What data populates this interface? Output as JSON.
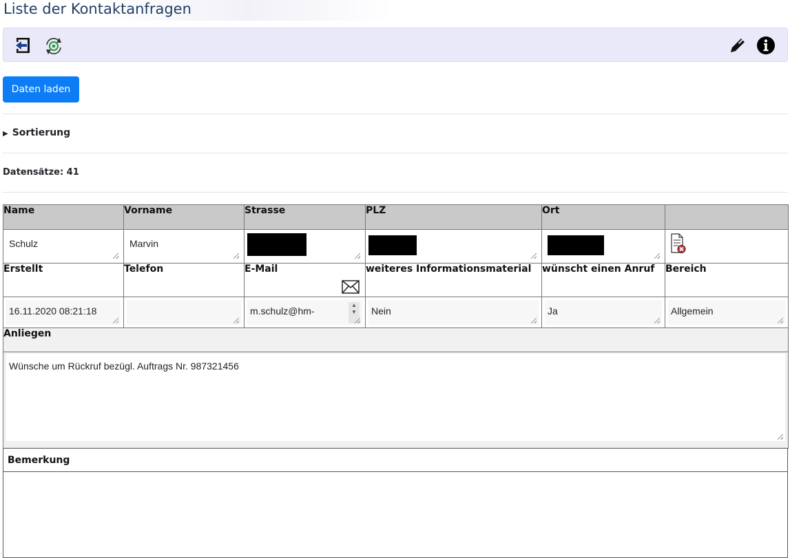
{
  "page": {
    "title": "Liste der Kontaktanfragen"
  },
  "toolbar": {
    "icons": [
      "back-icon",
      "refresh-icon",
      "edit-icon",
      "info-icon"
    ]
  },
  "load_button": {
    "label": "Daten laden"
  },
  "sort": {
    "label": "Sortierung"
  },
  "records": {
    "label": "Datensätze: 41"
  },
  "table": {
    "row1_headers": [
      "Name",
      "Vorname",
      "Strasse",
      "PLZ",
      "Ort",
      ""
    ],
    "row1_values": {
      "name": "Schulz",
      "vorname": "Marvin"
    },
    "row2_headers": [
      "Erstellt",
      "Telefon",
      "E-Mail",
      "weiteres Informationsmaterial",
      "wünscht einen Anruf",
      "Bereich"
    ],
    "row2_values": {
      "erstellt": "16.11.2020 08:21:18",
      "telefon": "",
      "email": "m.schulz@hm-",
      "info_material": "Nein",
      "anruf": "Ja",
      "bereich": "Allgemein"
    },
    "anliegen_label": "Anliegen",
    "anliegen_text": "Wünsche um Rückruf bezügl. Auftrags Nr. 987321456",
    "bemerkung_label": "Bemerkung"
  },
  "colors": {
    "title": "#1e3f66",
    "toolbar_bg": "#e9e9fa",
    "button_primary": "#0d7df5",
    "header_gray": "#c9c9c9"
  }
}
